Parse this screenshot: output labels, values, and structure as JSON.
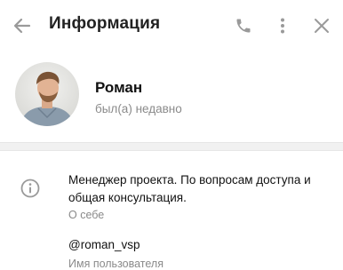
{
  "header": {
    "title": "Информация",
    "icons": {
      "back": "arrow-left-icon",
      "call": "phone-icon",
      "menu": "more-vertical-icon",
      "close": "close-icon"
    }
  },
  "profile": {
    "name": "Роман",
    "status": "был(а) недавно"
  },
  "details": {
    "bio_text": "Менеджер проекта. По вопросам доступа и общая консультация.",
    "bio_label": "О себе",
    "username_value": "@roman_vsp",
    "username_label": "Имя пользователя"
  },
  "colors": {
    "icon_gray": "#9a9a9a",
    "muted_text": "#8a8a8a",
    "divider": "#f1f1f1"
  }
}
